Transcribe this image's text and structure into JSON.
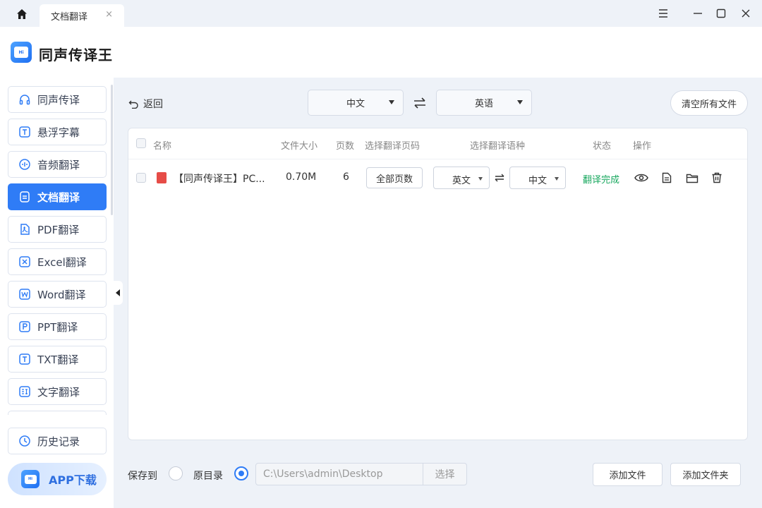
{
  "window": {
    "tab_title": "文档翻译",
    "tab_close": "×"
  },
  "header": {
    "app_title": "同声传译王"
  },
  "sidebar": {
    "items": [
      {
        "label": "同声传译",
        "icon": "headphones-icon"
      },
      {
        "label": "悬浮字幕",
        "icon": "subtitle-icon"
      },
      {
        "label": "音频翻译",
        "icon": "audio-icon"
      },
      {
        "label": "文档翻译",
        "icon": "document-icon",
        "active": true
      },
      {
        "label": "PDF翻译",
        "icon": "pdf-icon"
      },
      {
        "label": "Excel翻译",
        "icon": "excel-icon"
      },
      {
        "label": "Word翻译",
        "icon": "word-icon"
      },
      {
        "label": "PPT翻译",
        "icon": "ppt-icon"
      },
      {
        "label": "TXT翻译",
        "icon": "txt-icon"
      },
      {
        "label": "文字翻译",
        "icon": "text-translate-icon"
      }
    ],
    "history_label": "历史记录",
    "app_download_label": "APP下载"
  },
  "toolbar": {
    "back_label": "返回",
    "source_lang": "中文",
    "target_lang": "英语",
    "clear_label": "清空所有文件"
  },
  "table": {
    "headers": {
      "name": "名称",
      "size": "文件大小",
      "pages": "页数",
      "page_range": "选择翻译页码",
      "language": "选择翻译语种",
      "status": "状态",
      "actions": "操作"
    },
    "rows": [
      {
        "name": "【同声传译王】PC...",
        "size": "0.70M",
        "pages": "6",
        "page_range": "全部页数",
        "from_lang": "英文",
        "to_lang": "中文",
        "status": "翻译完成"
      }
    ]
  },
  "footer": {
    "save_to_label": "保存到",
    "original_dir_label": "原目录",
    "original_dir_selected": true,
    "path_value": "C:\\Users\\admin\\Desktop",
    "choose_label": "选择",
    "add_file_label": "添加文件",
    "add_folder_label": "添加文件夹"
  },
  "colors": {
    "accent": "#2f7cf6",
    "status_done": "#19a85f",
    "pdf_red": "#e64c47"
  }
}
